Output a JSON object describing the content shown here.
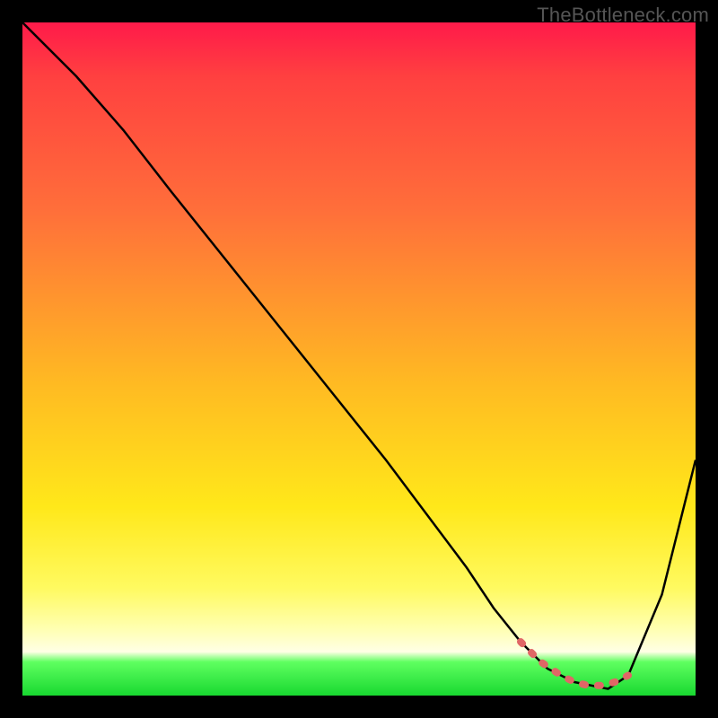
{
  "watermark": "TheBottleneck.com",
  "colors": {
    "page_bg": "#000000",
    "grad_top": "#ff1a4a",
    "grad_mid1": "#ff6f3a",
    "grad_mid2": "#ffe81a",
    "grad_low": "#ffffe5",
    "grad_bottom": "#18d830",
    "curve": "#000000",
    "trough_accent": "#e06666"
  },
  "chart_data": {
    "type": "line",
    "title": "",
    "xlabel": "",
    "ylabel": "",
    "xlim": [
      0,
      100
    ],
    "ylim": [
      0,
      100
    ],
    "series": [
      {
        "name": "main-curve",
        "x": [
          0,
          8,
          15,
          22,
          30,
          38,
          46,
          54,
          60,
          66,
          70,
          74,
          78,
          82,
          87,
          90,
          95,
          100
        ],
        "values": [
          100,
          92,
          84,
          75,
          65,
          55,
          45,
          35,
          27,
          19,
          13,
          8,
          4,
          2,
          1,
          3,
          15,
          35
        ]
      }
    ],
    "trough_highlight": {
      "x": [
        74,
        77,
        80,
        82,
        84,
        86,
        88,
        90
      ],
      "values": [
        8,
        5,
        3,
        2,
        1.5,
        1.5,
        2,
        3
      ]
    },
    "gradient_stops_percent": [
      0,
      8,
      28,
      54,
      72,
      84,
      90,
      93.5,
      95,
      100
    ]
  }
}
